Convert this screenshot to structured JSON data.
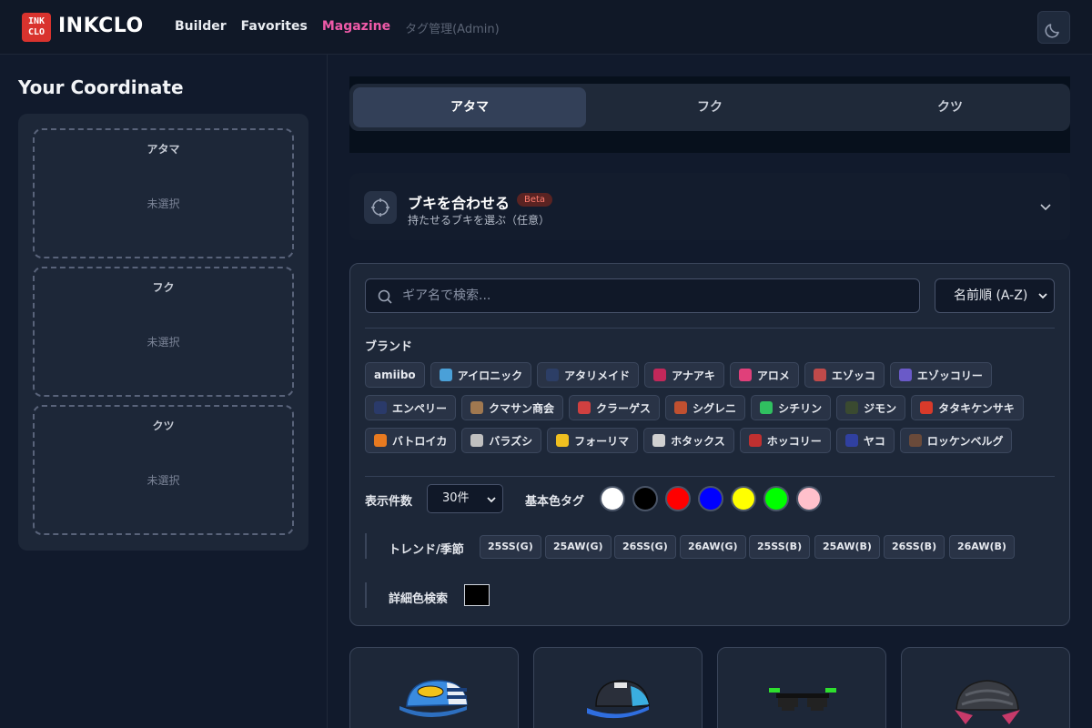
{
  "header": {
    "logo_line1": "INK",
    "logo_line2": "CLO",
    "brand": "INKCLO",
    "nav": [
      {
        "label": "Builder"
      },
      {
        "label": "Favorites"
      },
      {
        "label": "Magazine"
      },
      {
        "label": "タグ管理(Admin)"
      }
    ],
    "theme_icon": "moon-icon"
  },
  "sidebar": {
    "title": "Your Coordinate",
    "slots": [
      {
        "title": "アタマ",
        "status": "未選択"
      },
      {
        "title": "フク",
        "status": "未選択"
      },
      {
        "title": "クツ",
        "status": "未選択"
      }
    ]
  },
  "tabs": [
    {
      "label": "アタマ",
      "active": true
    },
    {
      "label": "フク",
      "active": false
    },
    {
      "label": "クツ",
      "active": false
    }
  ],
  "weapon": {
    "title": "ブキを合わせる",
    "badge": "Beta",
    "subtitle": "持たせるブキを選ぶ（任意）",
    "icon": "crosshair-icon"
  },
  "filter": {
    "search_placeholder": "ギア名で検索...",
    "sort_value": "名前順 (A-Z)",
    "brand_label": "ブランド",
    "brands": [
      [
        "amiibo",
        "アイロニック",
        "アタリメイド",
        "アナアキ",
        "アロメ",
        "エゾッコ",
        "エゾッコリー"
      ],
      [
        "エンペリー",
        "クマサン商会",
        "クラーゲス",
        "シグレニ",
        "シチリン",
        "ジモン",
        "タタキケンサキ"
      ],
      [
        "バトロイカ",
        "バラズシ",
        "フォーリマ",
        "ホタックス",
        "ホッコリー",
        "ヤコ",
        "ロッケンベルグ"
      ]
    ],
    "brand_colors": [
      [
        "",
        "#4aa0d8",
        "#2c3e66",
        "#c2285a",
        "#e0407a",
        "#c04a4a",
        "#6a5ac8"
      ],
      [
        "#2a3a6a",
        "#a07850",
        "#d04040",
        "#c05030",
        "#30c060",
        "#3a4a30",
        "#d83a2a"
      ],
      [
        "#e87a20",
        "#c0c0c0",
        "#f0c020",
        "#d0d0d0",
        "#c03030",
        "#3040a0",
        "#6a4a3a"
      ]
    ],
    "count_label": "表示件数",
    "count_value": "30件",
    "color_label": "基本色タグ",
    "colors": [
      "#ffffff",
      "#000000",
      "#ff0000",
      "#0000ff",
      "#ffff00",
      "#00ff00",
      "#ffc0cb"
    ],
    "trend_label": "トレンド/季節",
    "trends": [
      "25SS(G)",
      "25AW(G)",
      "26SS(G)",
      "26AW(G)",
      "25SS(B)",
      "25AW(B)",
      "26SS(B)",
      "26AW(B)"
    ],
    "detail_label": "詳細色検索",
    "detail_color": "#000000"
  },
  "gear_cards": [
    {
      "icon": "blue-trucker-cap-icon"
    },
    {
      "icon": "blue-black-cap-icon"
    },
    {
      "icon": "pixel-sunglasses-icon"
    },
    {
      "icon": "bike-helmet-icon"
    }
  ]
}
